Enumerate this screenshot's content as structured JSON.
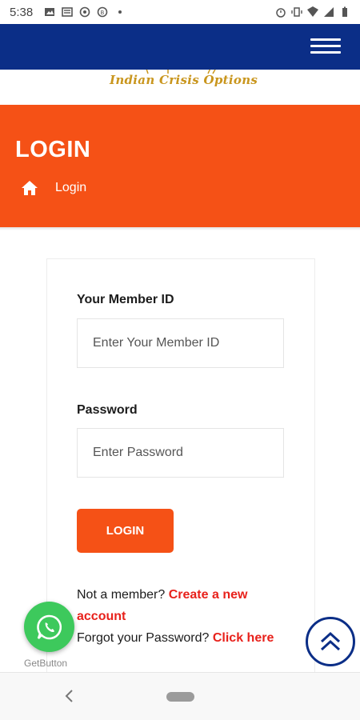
{
  "status_bar": {
    "time": "5:38",
    "left_icons": [
      "image-icon",
      "news-icon",
      "whatsapp-icon",
      "bixby-icon",
      "dot-icon"
    ],
    "right_icons": [
      "alarm-icon",
      "vibrate-icon",
      "wifi-icon",
      "signal-icon",
      "battery-icon"
    ]
  },
  "header": {
    "logo_text": "Indian Crisis Options",
    "menu_icon": "hamburger-icon",
    "bar_color": "#0b2e87"
  },
  "hero": {
    "title": "LOGIN",
    "breadcrumb_icon": "home-icon",
    "breadcrumb_label": "Login",
    "bg_color": "#f55116"
  },
  "form": {
    "member_id_label": "Your Member ID",
    "member_id_placeholder": "Enter Your Member ID",
    "member_id_value": "",
    "password_label": "Password",
    "password_placeholder": "Enter Password",
    "password_value": "",
    "login_button": "LOGIN"
  },
  "links": {
    "not_member_text": "Not a member? ",
    "create_account": "Create a new account",
    "forgot_text": "Forgot your Password? ",
    "click_here": "Click here",
    "link_color": "#e8211b"
  },
  "floating": {
    "whatsapp_icon": "whatsapp-icon",
    "getbutton_label": "GetButton",
    "scroll_top_icon": "double-chevron-up-icon"
  },
  "system_nav": {
    "back_icon": "back-icon",
    "home_icon": "home-pill-icon"
  }
}
